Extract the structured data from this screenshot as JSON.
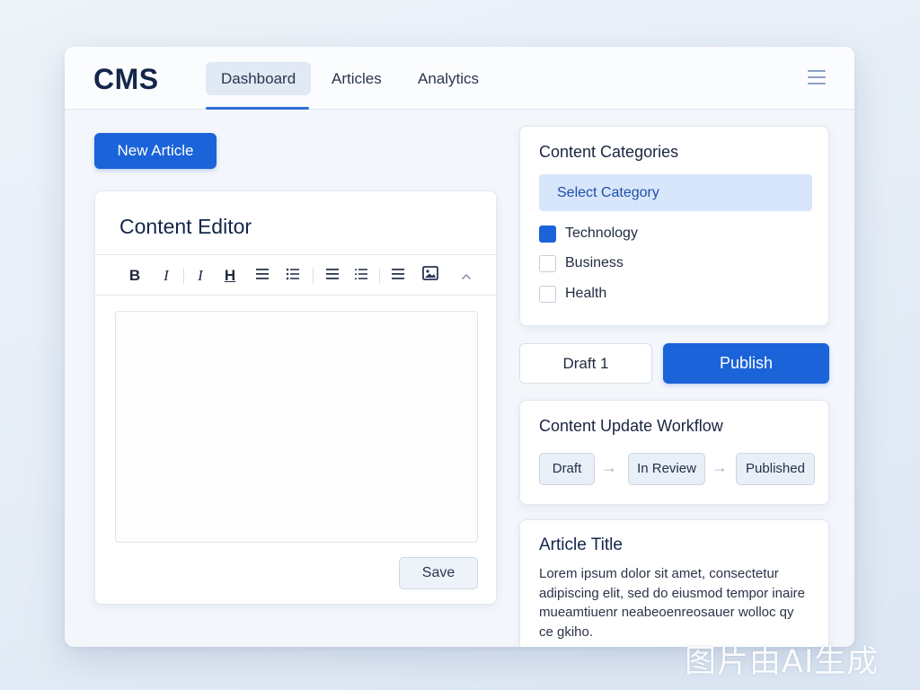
{
  "app": {
    "logo": "CMS",
    "nav_tabs": [
      {
        "label": "Dashboard",
        "active": true
      },
      {
        "label": "Articles",
        "active": false
      },
      {
        "label": "Analytics",
        "active": false
      }
    ],
    "menu_icon": "hamburger-menu-icon"
  },
  "toolbar": {
    "new_article_label": "New Article"
  },
  "editor": {
    "title": "Content Editor",
    "tools": {
      "bold": "B",
      "italic": "I",
      "italic_alt": "I",
      "heading": "H"
    },
    "icons": [
      "bold-icon",
      "italic-icon",
      "italic-alt-icon",
      "heading-icon",
      "align-icon",
      "bulleted-list-icon",
      "align-left-icon",
      "numbered-list-icon",
      "align-justify-icon",
      "image-icon",
      "chevron-up-icon"
    ],
    "save_label": "Save"
  },
  "categories": {
    "heading": "Content Categories",
    "select_placeholder": "Select Category",
    "items": [
      {
        "label": "Technology",
        "checked": true
      },
      {
        "label": "Business",
        "checked": false
      },
      {
        "label": "Health",
        "checked": false
      }
    ]
  },
  "actions": {
    "draft_label": "Draft 1",
    "publish_label": "Publish"
  },
  "workflow": {
    "heading": "Content Update Workflow",
    "steps": [
      "Draft",
      "In Review",
      "Published"
    ]
  },
  "article": {
    "title": "Article Title",
    "body": "Lorem ipsum dolor sit amet, consectetur adipiscing elit, sed do eiusmod tempor inaire mueamtiuenr neabeoenreosauer wolloc qy ce gkiho."
  },
  "watermark": "图片由AI生成",
  "colors": {
    "accent": "#1b63d8",
    "select_bg": "#d8e6fb",
    "background": "#e8eff7"
  }
}
